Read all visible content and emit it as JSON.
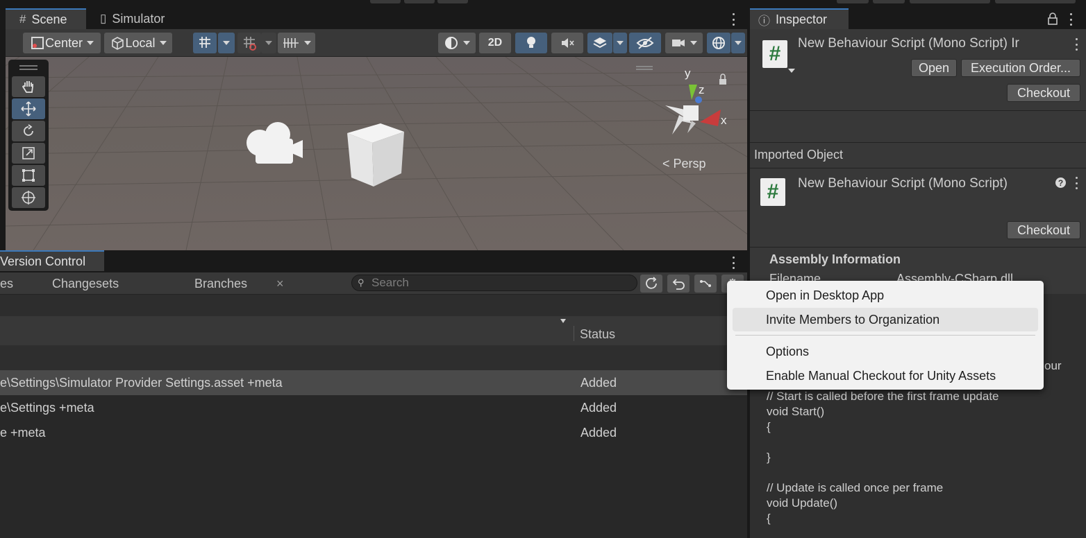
{
  "scene_panel": {
    "tabs": [
      {
        "label": "Scene",
        "icon": "grid-icon"
      },
      {
        "label": "Simulator",
        "icon": "device-icon"
      }
    ],
    "toolbar": {
      "pivot_label": "Center",
      "rotation_label": "Local",
      "mode_2d_label": "2D"
    },
    "gizmo": {
      "axis_y": "y",
      "axis_z": "z",
      "axis_x": "x",
      "projection_label": "Persp"
    }
  },
  "version_control": {
    "tab_label": "Version Control",
    "subtabs": [
      "es",
      "Changesets",
      "Branches"
    ],
    "close_glyph": "×",
    "search_placeholder": "Search",
    "column_status": "Status",
    "rows": [
      {
        "path": "e\\Settings\\Simulator Provider Settings.asset +meta",
        "status": "Added"
      },
      {
        "path": "e\\Settings +meta",
        "status": "Added"
      },
      {
        "path": "e +meta",
        "status": "Added"
      }
    ]
  },
  "inspector": {
    "tab_label": "Inspector",
    "script_title": "New Behaviour Script (Mono Script) Ir",
    "open_button": "Open",
    "execution_order_button": "Execution Order...",
    "checkout_button": "Checkout",
    "imported_object_label": "Imported Object",
    "imported_title": "New Behaviour Script (Mono Script)",
    "assembly_header": "Assembly Information",
    "filename_label": "Filename",
    "filename_value": "Assembly-CSharp.dll",
    "code_peek": "our",
    "code_lines": [
      "// Start is called before the first frame update",
      "void Start()",
      "{",
      "",
      "}",
      "",
      "// Update is called once per frame",
      "void Update()",
      "{"
    ]
  },
  "context_menu": {
    "items": [
      "Open in Desktop App",
      "Invite Members to Organization",
      "Options",
      "Enable Manual Checkout for Unity Assets"
    ]
  },
  "colors": {
    "selection_blue": "#46607c",
    "tab_accent": "#3a79bb",
    "script_icon_green": "#2c7a3e"
  }
}
